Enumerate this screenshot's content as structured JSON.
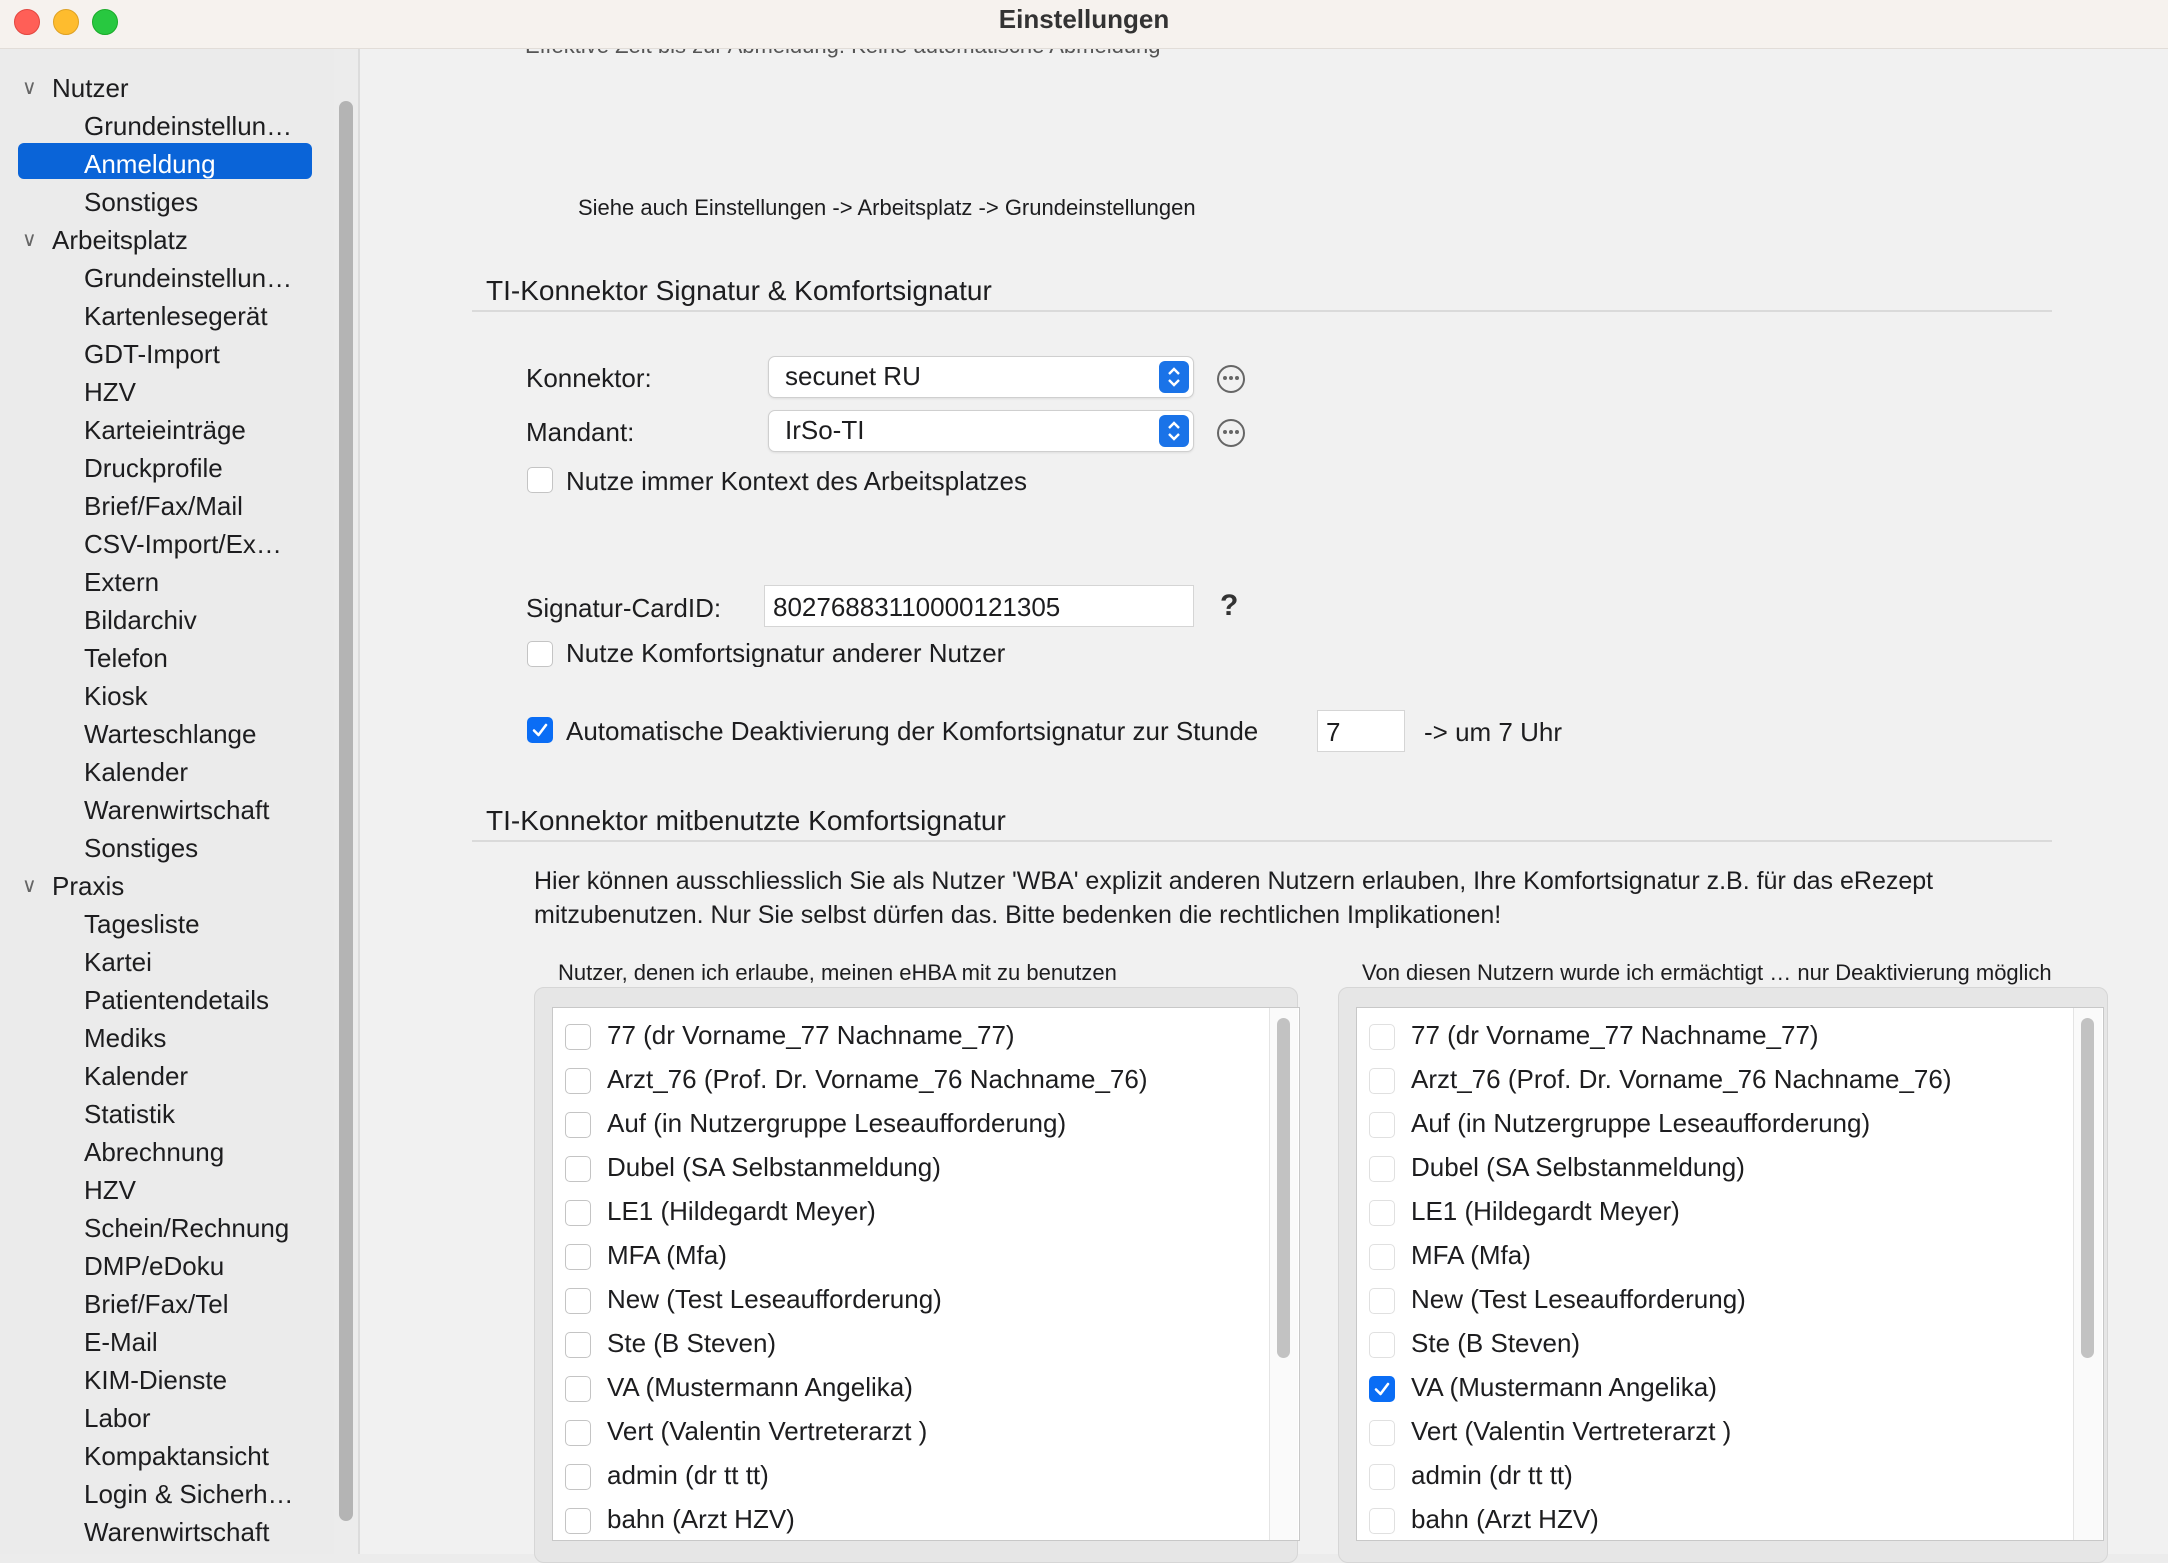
{
  "window": {
    "title": "Einstellungen"
  },
  "sidebar": {
    "groups": [
      {
        "label": "Nutzer",
        "items": [
          "Grundeinstellun…",
          "Anmeldung",
          "Sonstiges"
        ]
      },
      {
        "label": "Arbeitsplatz",
        "items": [
          "Grundeinstellun…",
          "Kartenlesegerät",
          "GDT-Import",
          "HZV",
          "Karteieinträge",
          "Druckprofile",
          "Brief/Fax/Mail",
          "CSV-Import/Ex…",
          "Extern",
          "Bildarchiv",
          "Telefon",
          "Kiosk",
          "Warteschlange",
          "Kalender",
          "Warenwirtschaft",
          "Sonstiges"
        ]
      },
      {
        "label": "Praxis",
        "items": [
          "Tagesliste",
          "Kartei",
          "Patientendetails",
          "Mediks",
          "Kalender",
          "Statistik",
          "Abrechnung",
          "HZV",
          "Schein/Rechnung",
          "DMP/eDoku",
          "Brief/Fax/Tel",
          "E-Mail",
          "KIM-Dienste",
          "Labor",
          "Kompaktansicht",
          "Login & Sicherh…",
          "Warenwirtschaft"
        ]
      }
    ],
    "selected": "Anmeldung"
  },
  "main": {
    "cut_text": "Effektive Zeit bis zur Abmeldung: Keine automatische Abmeldung",
    "see_also": "Siehe auch Einstellungen -> Arbeitsplatz -> Grundeinstellungen",
    "signature_section": {
      "title": "TI-Konnektor Signatur & Komfortsignatur",
      "konnektor_label": "Konnektor:",
      "konnektor_value": "secunet RU",
      "mandant_label": "Mandant:",
      "mandant_value": "IrSo-TI",
      "use_context_label": "Nutze immer Kontext des Arbeitsplatzes",
      "use_context_checked": false,
      "card_id_label": "Signatur-CardID:",
      "card_id_value": "80276883110000121305",
      "help_glyph": "?",
      "use_other_label": "Nutze Komfortsignatur anderer Nutzer",
      "use_other_checked": false,
      "auto_deactivate_label": "Automatische Deaktivierung der Komfortsignatur zur Stunde",
      "auto_deactivate_checked": true,
      "hour_value": "7",
      "hour_suffix": "-> um 7 Uhr"
    },
    "shared_section": {
      "title": "TI-Konnektor mitbenutzte Komfortsignatur",
      "description_line1": "Hier können ausschliesslich Sie als Nutzer 'WBA' explizit anderen Nutzern erlauben, Ihre Komfortsignatur z.B. für das eRezept",
      "description_line2": "mitzubenutzen. Nur Sie selbst dürfen das. Bitte bedenken die rechtlichen Implikationen!",
      "left_list": {
        "title": "Nutzer, denen ich erlaube, meinen eHBA mit zu benutzen",
        "items": [
          {
            "label": "77 (dr Vorname_77 Nachname_77)",
            "checked": false
          },
          {
            "label": "Arzt_76 (Prof. Dr. Vorname_76 Nachname_76)",
            "checked": false
          },
          {
            "label": "Auf (in Nutzergruppe Leseaufforderung)",
            "checked": false
          },
          {
            "label": "Dubel (SA Selbstanmeldung)",
            "checked": false
          },
          {
            "label": "LE1 (Hildegardt Meyer)",
            "checked": false
          },
          {
            "label": "MFA (Mfa)",
            "checked": false
          },
          {
            "label": "New (Test Leseaufforderung)",
            "checked": false
          },
          {
            "label": "Ste (B Steven)",
            "checked": false
          },
          {
            "label": "VA (Mustermann Angelika)",
            "checked": false
          },
          {
            "label": "Vert (Valentin Vertreterarzt )",
            "checked": false
          },
          {
            "label": "admin (dr tt tt)",
            "checked": false
          },
          {
            "label": "bahn (Arzt HZV)",
            "checked": false
          }
        ]
      },
      "right_list": {
        "title": "Von diesen Nutzern wurde ich ermächtigt … nur Deaktivierung möglich",
        "items": [
          {
            "label": "77 (dr Vorname_77 Nachname_77)",
            "checked": false
          },
          {
            "label": "Arzt_76 (Prof. Dr. Vorname_76 Nachname_76)",
            "checked": false
          },
          {
            "label": "Auf (in Nutzergruppe Leseaufforderung)",
            "checked": false
          },
          {
            "label": "Dubel (SA Selbstanmeldung)",
            "checked": false
          },
          {
            "label": "LE1 (Hildegardt Meyer)",
            "checked": false
          },
          {
            "label": "MFA (Mfa)",
            "checked": false
          },
          {
            "label": "New (Test Leseaufforderung)",
            "checked": false
          },
          {
            "label": "Ste (B Steven)",
            "checked": false
          },
          {
            "label": "VA (Mustermann Angelika)",
            "checked": true
          },
          {
            "label": "Vert (Valentin Vertreterarzt )",
            "checked": false
          },
          {
            "label": "admin (dr tt tt)",
            "checked": false
          },
          {
            "label": "bahn (Arzt HZV)",
            "checked": false
          }
        ]
      }
    }
  },
  "colors": {
    "accent": "#0a64d8",
    "checkbox_checked": "#0a6df5",
    "sidebar_bg": "#ebebeb",
    "content_bg": "#f1f1f1"
  }
}
